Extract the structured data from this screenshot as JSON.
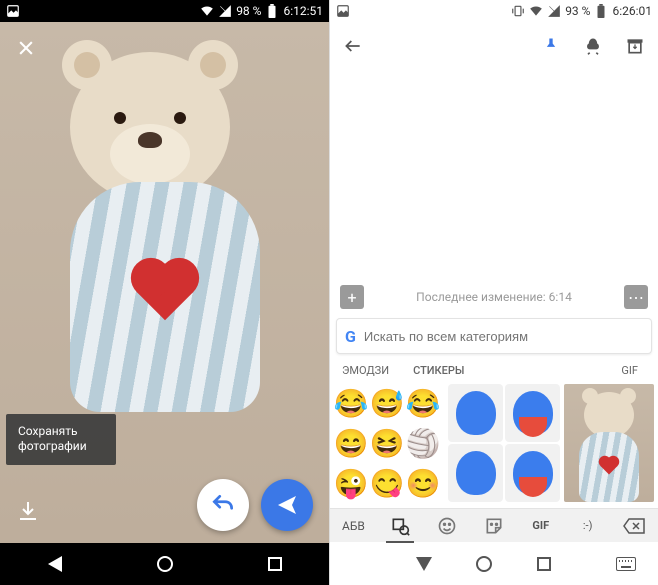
{
  "left": {
    "status": {
      "battery": "98 %",
      "time": "6:12:51"
    },
    "tooltip": "Сохранять фотографии",
    "icons": {
      "close": "close-icon",
      "download": "download-icon",
      "undo": "undo-icon",
      "send": "send-icon"
    }
  },
  "right": {
    "status": {
      "battery": "93 %",
      "time": "6:26:01"
    },
    "appbar": {
      "back": "back-icon",
      "pin": "pin-icon",
      "remind": "remind-icon",
      "archive": "archive-icon"
    },
    "note": {
      "add": "+",
      "last_edit": "Последнее изменение: 6:14",
      "more": "⋯"
    },
    "search": {
      "placeholder": "Искать по всем категориям"
    },
    "tabs": {
      "emoji": "ЭМОДЗИ",
      "stickers": "СТИКЕРЫ",
      "gif": "GIF"
    },
    "emoji_grid": [
      "😂",
      "😅",
      "😂",
      "😄",
      "😆",
      "🏐",
      "😜",
      "😋",
      "😊"
    ],
    "kb": {
      "abc": "АБВ",
      "recent": "recent-icon",
      "smiley": "smiley-icon",
      "sticker": "sticker-icon",
      "gif": "GIF",
      "text": ":-)",
      "backspace": "backspace-icon"
    }
  }
}
